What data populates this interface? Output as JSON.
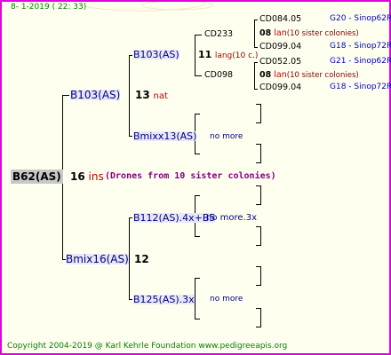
{
  "header": {
    "date_line": "8-  1-2019 ( 22: 33)"
  },
  "footer": {
    "copyright": "Copyright 2004-2019 @ Karl Kehrle Foundation    www.pedigreeapis.org"
  },
  "root": {
    "label": "B62(AS)",
    "number": "16",
    "suffix": "ins",
    "note": "(Drones from 10 sister colonies)"
  },
  "gen1": {
    "top": {
      "label": "B103(AS)",
      "number": "13",
      "suffix": "nat"
    },
    "bottom": {
      "label": "Bmix16(AS)",
      "number": "12"
    }
  },
  "gen2": {
    "a": {
      "label": "B103(AS)",
      "number": "11",
      "suffix": "lang",
      "extra": "(10 c.)"
    },
    "b": {
      "label": "Bmixx13(AS)",
      "note": "no more"
    },
    "c": {
      "label": "B112(AS).4x+B5",
      "note": "no more.3x"
    },
    "d": {
      "label": "B125(AS).3x",
      "note": "no more"
    }
  },
  "gen3": {
    "cd233": {
      "label": "CD233",
      "number": "08",
      "suffix": "lan",
      "extra": "(10 sister colonies)"
    },
    "cd098": {
      "label": "CD098",
      "number": "08",
      "suffix": "lan",
      "extra": "(10 sister colonies)"
    }
  },
  "gen4": {
    "l1": {
      "label": "CD084.05",
      "tag": "G20 - Sinop62R"
    },
    "l2": {
      "label": "CD099.04",
      "tag": "G18 - Sinop72R"
    },
    "l3": {
      "label": "CD052.05",
      "tag": "G21 - Sinop62R"
    },
    "l4": {
      "label": "CD099.04",
      "tag": "G18 - Sinop72R"
    }
  }
}
